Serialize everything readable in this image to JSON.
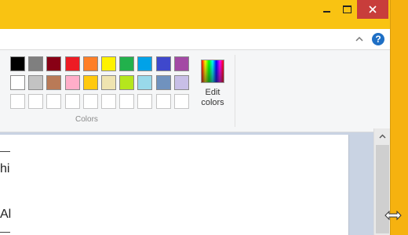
{
  "window": {
    "titlebar_color": "#f9c312",
    "close_color": "#c83d3b",
    "buttons": [
      "minimize-icon",
      "maximize-icon",
      "close-icon"
    ]
  },
  "ribbon": {
    "help_symbol": "?",
    "collapse_icon": "chevron-up-icon",
    "group_label": "Colors",
    "edit_colors": {
      "line1": "Edit",
      "line2": "colors"
    }
  },
  "palette": {
    "row1": [
      "#000000",
      "#7f7f7f",
      "#880015",
      "#ed1c24",
      "#ff7f27",
      "#fff200",
      "#22b14c",
      "#00a2e8",
      "#3f48cc",
      "#a349a4"
    ],
    "row2": [
      "#ffffff",
      "#c3c3c3",
      "#b97a57",
      "#ffaec9",
      "#ffc90e",
      "#efe4b0",
      "#b5e61d",
      "#99d9ea",
      "#7092be",
      "#c8bfe7"
    ],
    "row3_empty_count": 10
  },
  "canvas": {
    "fragment_top": "hi",
    "fragment_bottom": "Al"
  },
  "colors": {
    "side_stripe": "#f6b20f",
    "workspace": "#c9d3e3"
  }
}
